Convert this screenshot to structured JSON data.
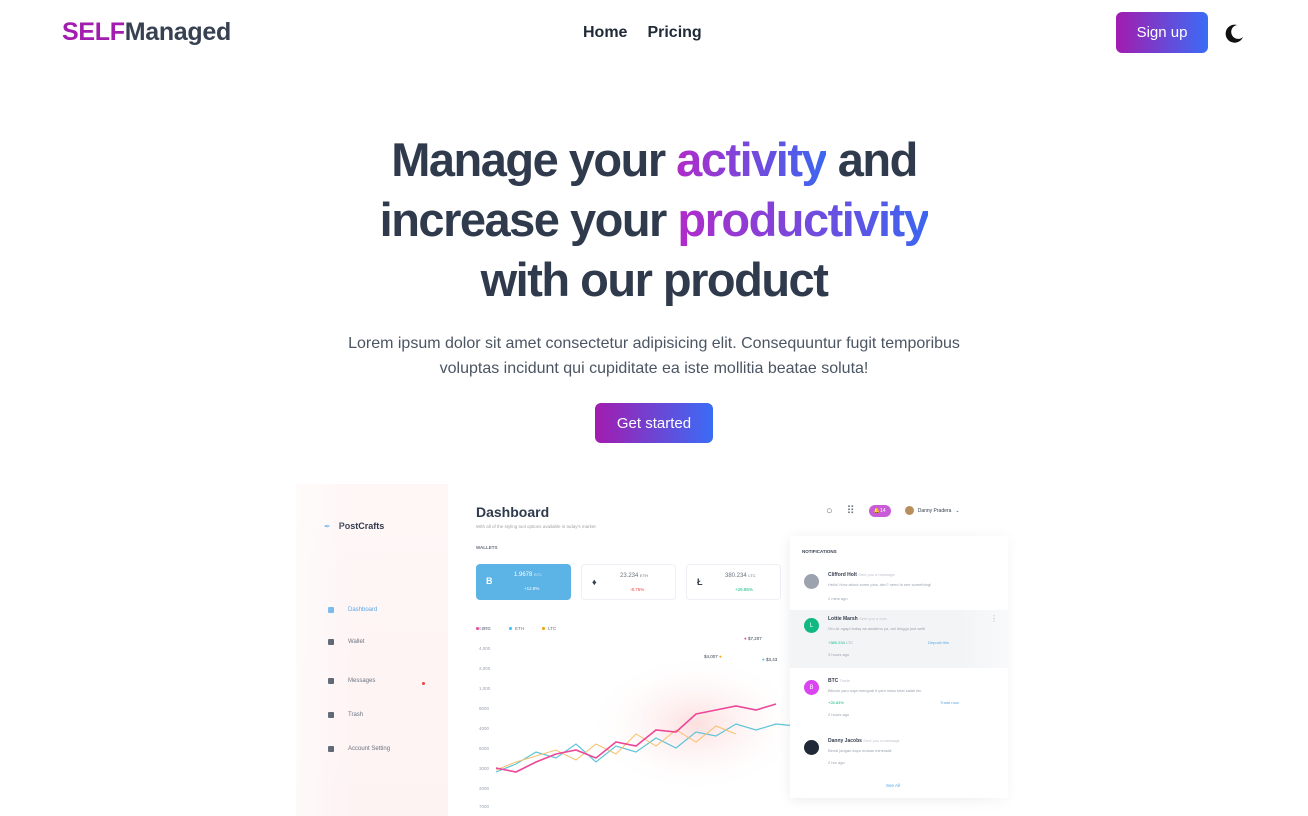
{
  "nav": {
    "logo_part1": "SELF",
    "logo_part2": "Managed",
    "links": [
      "Home",
      "Pricing"
    ],
    "signup_label": "Sign up",
    "theme_toggle_icon": "moon-icon"
  },
  "hero": {
    "line1_pre": "Manage your ",
    "line1_accent": "activity",
    "line1_post": " and",
    "line2_pre": "increase your ",
    "line2_accent": "productivity",
    "line3": "with our product",
    "subtitle": "Lorem ipsum dolor sit amet consectetur adipisicing elit. Consequuntur fugit temporibus voluptas incidunt qui cupiditate ea iste mollitia beatae soluta!",
    "cta_label": "Get started"
  },
  "colors": {
    "brand_purple": "#a21caf",
    "brand_blue": "#3b6cf6",
    "heading": "#2f3a4c"
  },
  "mockup": {
    "brand": "PostCrafts",
    "sidebar": [
      "Dashboard",
      "Wallet",
      "Messages",
      "Trash",
      "Account Setting"
    ],
    "title": "Dashboard",
    "subtitle": "With all of the styling tool options available in today's market",
    "wallets_label": "WALLETS",
    "wallets": [
      {
        "symbol": "B",
        "value": "1.9678",
        "unit": "BTC",
        "change": "+12.8%"
      },
      {
        "symbol": "♦",
        "value": "23.234",
        "unit": "ETH",
        "change": "-8.75%"
      },
      {
        "symbol": "Ł",
        "value": "380.234",
        "unit": "LTC",
        "change": "+26.85%"
      }
    ],
    "legend": [
      "BTC",
      "ETH",
      "LTC"
    ],
    "y_labels": [
      "6,000",
      "4,000",
      "2,000",
      "1,000",
      "8000",
      "4000",
      "6000",
      "3000",
      "2000",
      "7000"
    ],
    "tags": [
      "$7,207",
      "$4,007",
      "$3,43"
    ],
    "user_name": "Danny Pradera",
    "badge": "14",
    "notifications_label": "NOTIFICATIONS",
    "notifications": [
      {
        "name": "Clifford Holt",
        "meta": "Sent you a message",
        "text": "Hello! How about some pics, dev? need to see something!",
        "time": "2 mins ago"
      },
      {
        "name": "Lottie Marsh",
        "meta": "Sent you a coin",
        "text": "Oro Ar ngapi today as anakimu ya, ani dinggo just welli",
        "amount": "+380.234",
        "unit": "LTC",
        "link": "Deposit this",
        "time": "3 hours ago"
      },
      {
        "name": "BTC",
        "meta": "Trade",
        "text": "Bitcoin yaru naja mengudi it yam ndau total salah kiu",
        "amount": "+26.83%",
        "link": "Trade now",
        "time": "2 hours ago"
      },
      {
        "name": "Danny Jacobs",
        "meta": "Sent you a message",
        "text": "Bendi jangan kayo mokan mineraali",
        "time": "2 hrs ago"
      }
    ],
    "see_all": "See All"
  }
}
